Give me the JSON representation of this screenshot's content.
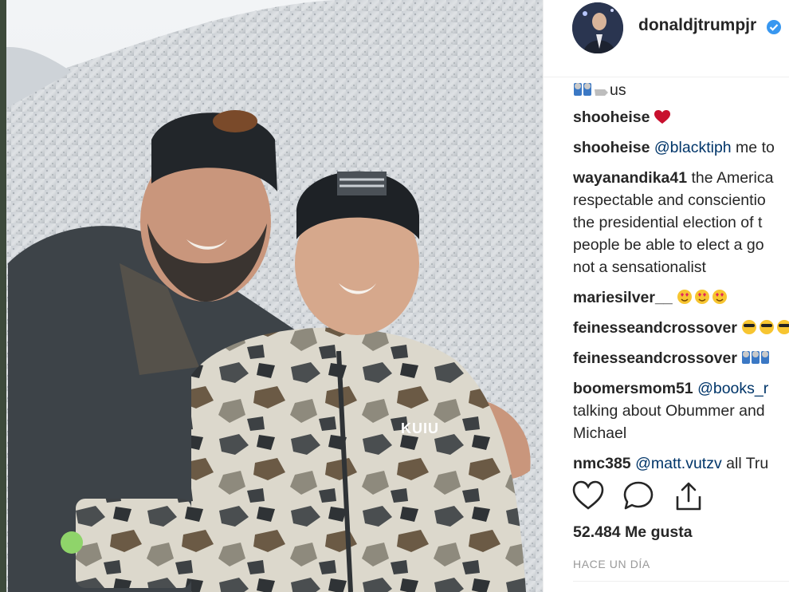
{
  "post": {
    "username": "donaldjtrumpjr",
    "likes_text": "52.484 Me gusta",
    "timestamp": "HACE UN DÍA",
    "photo": {
      "jacket_brand": "KUIU"
    }
  },
  "comments": [
    {
      "user": "",
      "mention": "",
      "text": "us",
      "emoji": "praise-hands-pointing-hand"
    },
    {
      "user": "shooheise",
      "mention": "",
      "text": "",
      "emoji": "red-heart"
    },
    {
      "user": "shooheise",
      "mention": "@blacktiph",
      "text": " me to",
      "emoji": ""
    },
    {
      "user": "wayanandika41",
      "mention": "",
      "text": " the America",
      "emoji": ""
    },
    {
      "user": "",
      "mention": "",
      "text": "respectable and conscientio",
      "emoji": ""
    },
    {
      "user": "",
      "mention": "",
      "text": "the presidential election of t",
      "emoji": ""
    },
    {
      "user": "",
      "mention": "",
      "text": "people be able to elect a go",
      "emoji": ""
    },
    {
      "user": "",
      "mention": "",
      "text": "not a sensationalist",
      "emoji": ""
    },
    {
      "user": "mariesilver__",
      "mention": "",
      "text": "",
      "emoji": "heart-eyes-faces"
    },
    {
      "user": "feinesseandcrossover",
      "mention": "",
      "text": "",
      "emoji": "sunglasses-faces"
    },
    {
      "user": "feinesseandcrossover",
      "mention": "",
      "text": "",
      "emoji": "praise-hands"
    },
    {
      "user": "boomersmom51",
      "mention": "@books_r",
      "text": "",
      "emoji": ""
    },
    {
      "user": "",
      "mention": "",
      "text": "talking about Obummer and",
      "emoji": ""
    },
    {
      "user": "",
      "mention": "",
      "text": "Michael",
      "emoji": ""
    },
    {
      "user": "nmc385",
      "mention": "@matt.vutzv",
      "text": " all Tru",
      "emoji": ""
    }
  ],
  "icons": {
    "verified": "verified-badge-icon",
    "like": "heart-outline-icon",
    "comment": "speech-bubble-icon",
    "share": "share-upload-icon"
  },
  "colors": {
    "verified": "#3897f0",
    "heart": "#ed4956",
    "mention": "#003569",
    "timestamp": "#999999"
  }
}
